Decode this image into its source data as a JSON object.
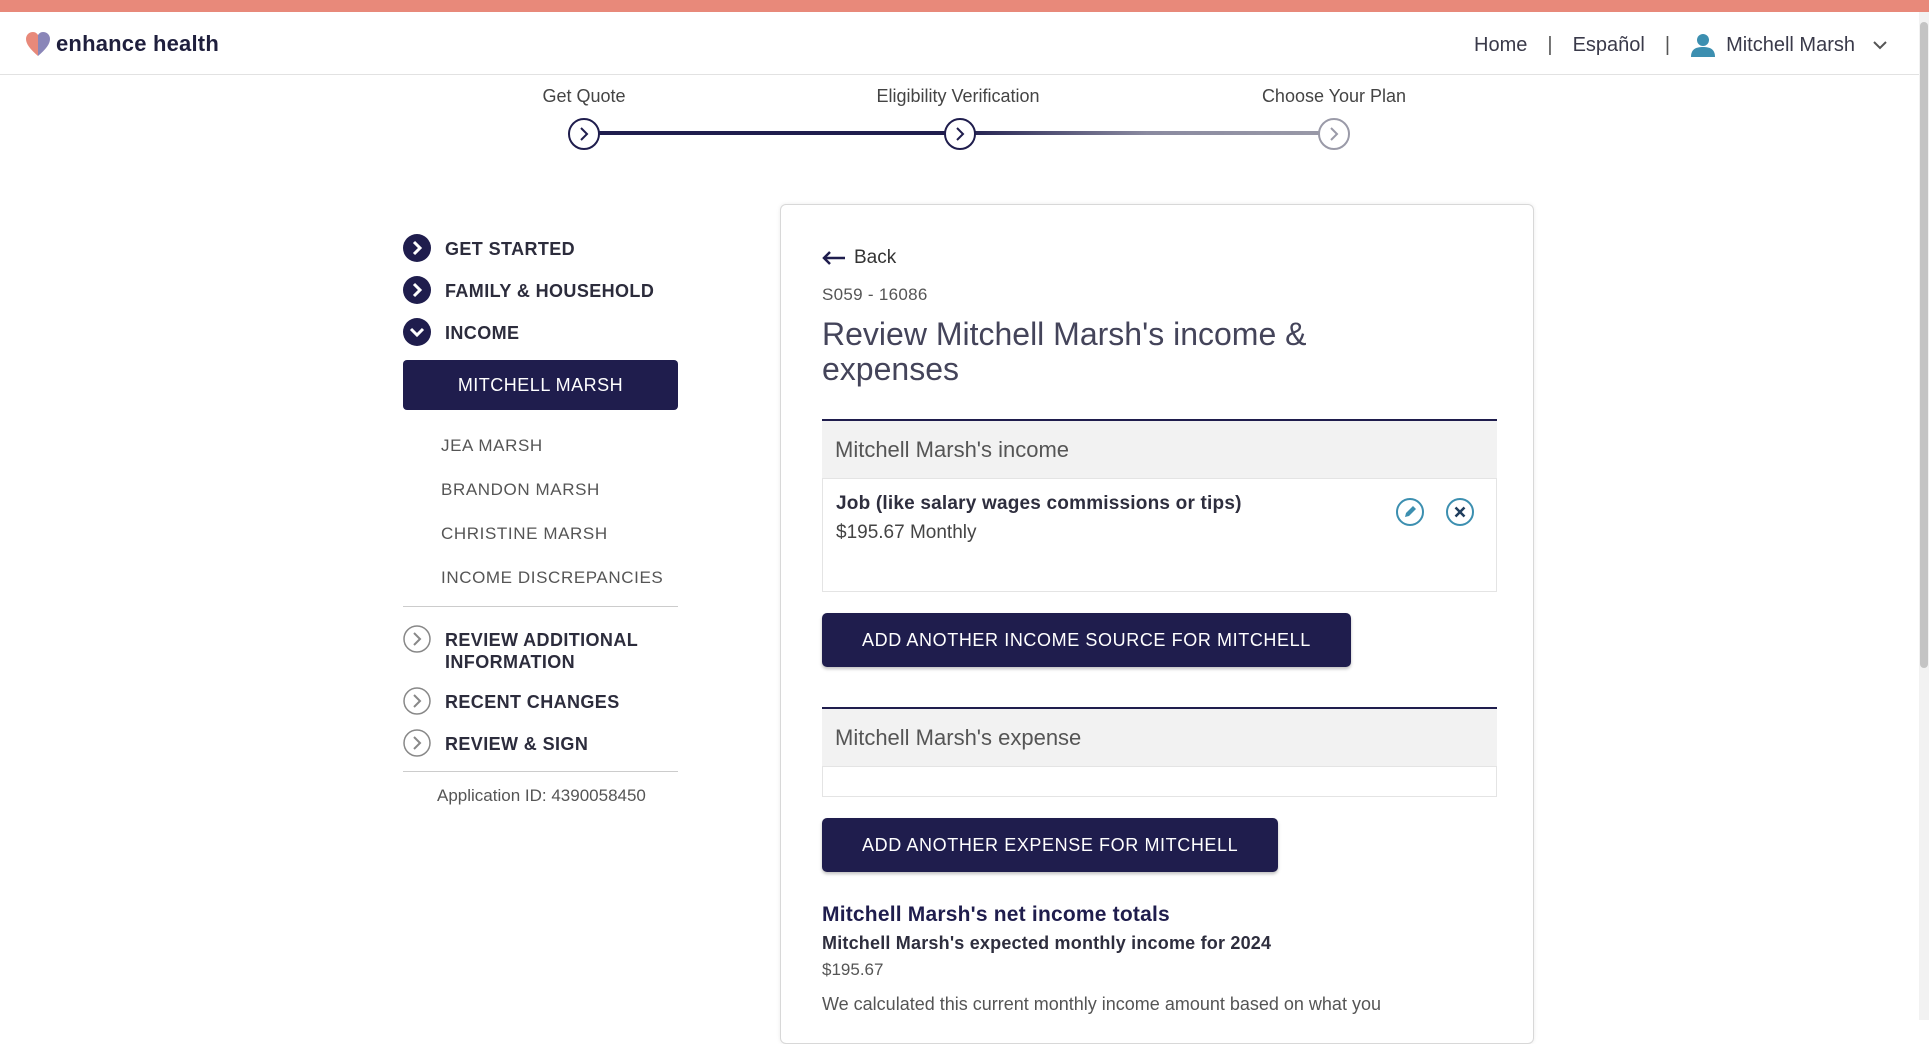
{
  "colors": {
    "accent": "#1f1d4d",
    "stripe": "#e8897a",
    "icon_teal": "#3c8fb0"
  },
  "header": {
    "brand": "enhance health",
    "nav": {
      "home": "Home",
      "separator": "|",
      "language": "Español",
      "user": "Mitchell Marsh"
    }
  },
  "stepper": {
    "steps": [
      {
        "label": "Get Quote"
      },
      {
        "label": "Eligibility Verification"
      },
      {
        "label": "Choose Your Plan"
      }
    ]
  },
  "sidebar": {
    "sections": [
      {
        "label": "GET STARTED",
        "icon": "chevron-right-filled-icon"
      },
      {
        "label": "FAMILY & HOUSEHOLD",
        "icon": "chevron-right-filled-icon"
      },
      {
        "label": "INCOME",
        "icon": "chevron-down-filled-icon"
      }
    ],
    "income_members": {
      "active": "MITCHELL MARSH",
      "others": [
        "JEA MARSH",
        "BRANDON MARSH",
        "CHRISTINE MARSH",
        "INCOME DISCREPANCIES"
      ]
    },
    "later_sections": [
      {
        "label": "REVIEW ADDITIONAL INFORMATION",
        "icon": "chevron-right-outline-icon"
      },
      {
        "label": "RECENT CHANGES",
        "icon": "chevron-right-outline-icon"
      },
      {
        "label": "REVIEW & SIGN",
        "icon": "chevron-right-outline-icon"
      }
    ],
    "application_id": "Application ID: 4390058450"
  },
  "main": {
    "back_label": "Back",
    "case_id": "S059 - 16086",
    "title": "Review Mitchell Marsh's income & expenses",
    "income_panel": {
      "heading": "Mitchell Marsh's income",
      "items": [
        {
          "title": "Job (like salary wages commissions or tips)",
          "amount": "$195.67 Monthly"
        }
      ]
    },
    "add_income_button": "ADD ANOTHER INCOME SOURCE FOR MITCHELL",
    "expense_panel": {
      "heading": "Mitchell Marsh's expense"
    },
    "add_expense_button": "ADD ANOTHER EXPENSE FOR MITCHELL",
    "totals": {
      "heading": "Mitchell Marsh's net income totals",
      "subheading": "Mitchell Marsh's expected monthly income for 2024",
      "value": "$195.67",
      "note": "We calculated this current monthly income amount based on what you"
    }
  }
}
